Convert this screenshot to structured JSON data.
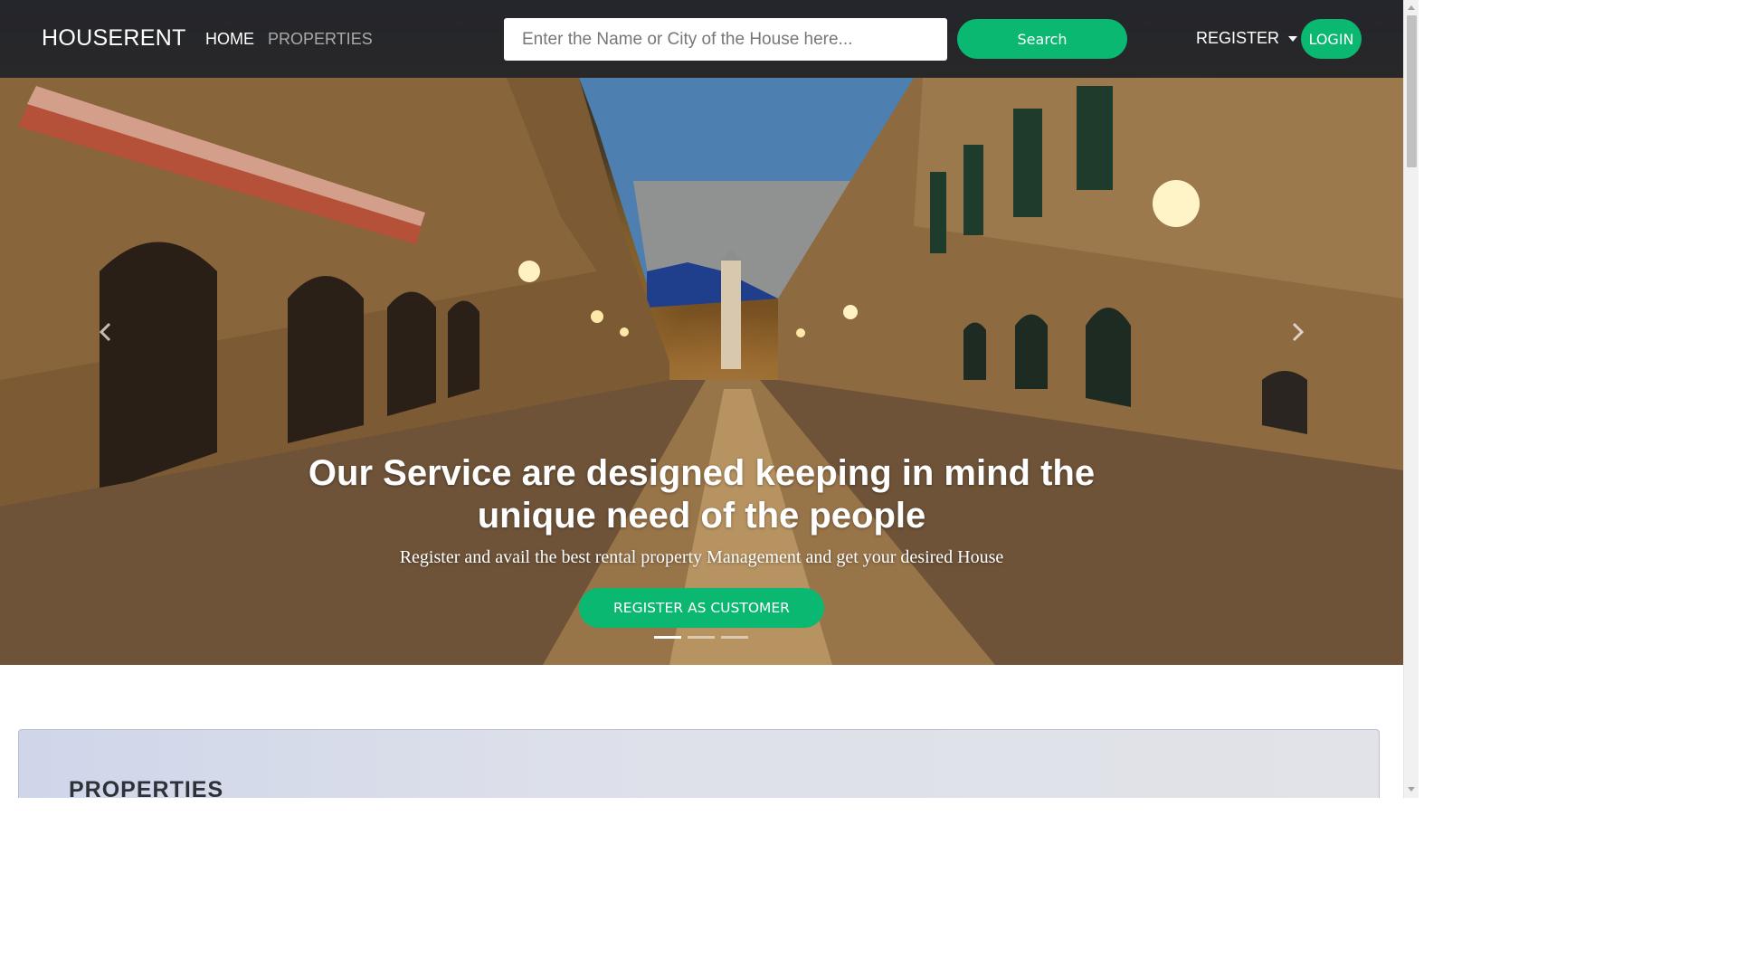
{
  "navbar": {
    "brand": "HOUSERENT",
    "links": [
      {
        "label": "HOME",
        "active": true
      },
      {
        "label": "PROPERTIES",
        "active": false
      }
    ],
    "search": {
      "placeholder": "Enter the Name or City of the House here...",
      "value": "",
      "button_label": "Search"
    },
    "register_label": "REGISTER",
    "login_label": "LOGIN"
  },
  "hero": {
    "title": "Our Service are designed keeping in mind the unique need of the people",
    "subtitle": "Register and avail the best rental property Management and get your desired House",
    "cta_label": "REGISTER AS CUSTOMER",
    "slide_count": 3,
    "active_slide": 0,
    "prev_icon": "chevron-left-icon",
    "next_icon": "chevron-right-icon"
  },
  "properties": {
    "heading": "PROPERTIES"
  },
  "colors": {
    "accent": "#0bb871",
    "navbar_bg": "#222428",
    "text_light": "#ffffff"
  }
}
